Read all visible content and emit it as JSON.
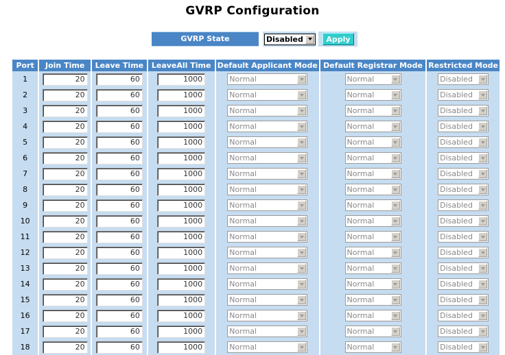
{
  "page": {
    "title": "GVRP Configuration"
  },
  "gvrp": {
    "state_label": "GVRP State",
    "state_value": "Disabled",
    "apply_label": "Apply"
  },
  "table": {
    "headers": [
      "Port",
      "Join Time",
      "Leave Time",
      "LeaveAll Time",
      "Default Applicant Mode",
      "Default Registrar Mode",
      "Restricted Mode"
    ],
    "rows": [
      {
        "port": "1",
        "join": "20",
        "leave": "60",
        "leaveall": "1000",
        "applicant": "Normal",
        "registrar": "Normal",
        "restricted": "Disabled"
      },
      {
        "port": "2",
        "join": "20",
        "leave": "60",
        "leaveall": "1000",
        "applicant": "Normal",
        "registrar": "Normal",
        "restricted": "Disabled"
      },
      {
        "port": "3",
        "join": "20",
        "leave": "60",
        "leaveall": "1000",
        "applicant": "Normal",
        "registrar": "Normal",
        "restricted": "Disabled"
      },
      {
        "port": "4",
        "join": "20",
        "leave": "60",
        "leaveall": "1000",
        "applicant": "Normal",
        "registrar": "Normal",
        "restricted": "Disabled"
      },
      {
        "port": "5",
        "join": "20",
        "leave": "60",
        "leaveall": "1000",
        "applicant": "Normal",
        "registrar": "Normal",
        "restricted": "Disabled"
      },
      {
        "port": "6",
        "join": "20",
        "leave": "60",
        "leaveall": "1000",
        "applicant": "Normal",
        "registrar": "Normal",
        "restricted": "Disabled"
      },
      {
        "port": "7",
        "join": "20",
        "leave": "60",
        "leaveall": "1000",
        "applicant": "Normal",
        "registrar": "Normal",
        "restricted": "Disabled"
      },
      {
        "port": "8",
        "join": "20",
        "leave": "60",
        "leaveall": "1000",
        "applicant": "Normal",
        "registrar": "Normal",
        "restricted": "Disabled"
      },
      {
        "port": "9",
        "join": "20",
        "leave": "60",
        "leaveall": "1000",
        "applicant": "Normal",
        "registrar": "Normal",
        "restricted": "Disabled"
      },
      {
        "port": "10",
        "join": "20",
        "leave": "60",
        "leaveall": "1000",
        "applicant": "Normal",
        "registrar": "Normal",
        "restricted": "Disabled"
      },
      {
        "port": "11",
        "join": "20",
        "leave": "60",
        "leaveall": "1000",
        "applicant": "Normal",
        "registrar": "Normal",
        "restricted": "Disabled"
      },
      {
        "port": "12",
        "join": "20",
        "leave": "60",
        "leaveall": "1000",
        "applicant": "Normal",
        "registrar": "Normal",
        "restricted": "Disabled"
      },
      {
        "port": "13",
        "join": "20",
        "leave": "60",
        "leaveall": "1000",
        "applicant": "Normal",
        "registrar": "Normal",
        "restricted": "Disabled"
      },
      {
        "port": "14",
        "join": "20",
        "leave": "60",
        "leaveall": "1000",
        "applicant": "Normal",
        "registrar": "Normal",
        "restricted": "Disabled"
      },
      {
        "port": "15",
        "join": "20",
        "leave": "60",
        "leaveall": "1000",
        "applicant": "Normal",
        "registrar": "Normal",
        "restricted": "Disabled"
      },
      {
        "port": "16",
        "join": "20",
        "leave": "60",
        "leaveall": "1000",
        "applicant": "Normal",
        "registrar": "Normal",
        "restricted": "Disabled"
      },
      {
        "port": "17",
        "join": "20",
        "leave": "60",
        "leaveall": "1000",
        "applicant": "Normal",
        "registrar": "Normal",
        "restricted": "Disabled"
      },
      {
        "port": "18",
        "join": "20",
        "leave": "60",
        "leaveall": "1000",
        "applicant": "Normal",
        "registrar": "Normal",
        "restricted": "Disabled"
      }
    ]
  },
  "icons": {
    "dropdown": "chevron-down-icon"
  },
  "colors": {
    "header_bg": "#4a86c6",
    "row_bg": "#c6dcf0",
    "apply_bg": "#33cccc"
  }
}
